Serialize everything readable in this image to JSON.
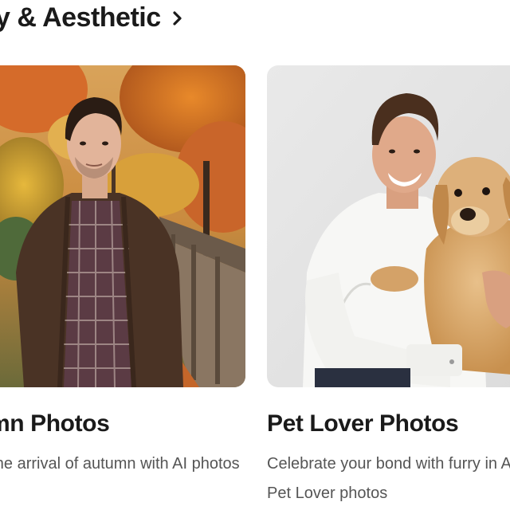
{
  "section": {
    "title": "y & Aesthetic",
    "chevron_icon": "chevron-right-icon"
  },
  "cards": [
    {
      "title": "mn Photos",
      "description": "te the arrival of autumn with AI photos",
      "image_subject": "man in brown cardigan on wooden bridge in autumn forest"
    },
    {
      "title": "Pet Lover Photos",
      "description": "Celebrate your bond with furry in AI Pet Lover photos",
      "image_subject": "smiling man in white shirt hugging golden retriever puppy"
    }
  ],
  "colors": {
    "text": "#1a1a1a",
    "muted_text": "#555555",
    "background": "#ffffff"
  }
}
